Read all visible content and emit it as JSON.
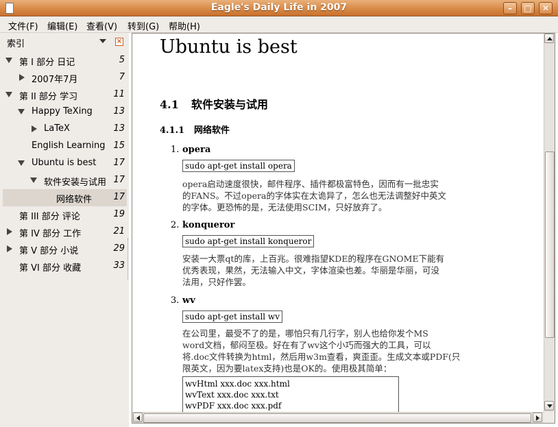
{
  "window": {
    "title": "Eagle's Daily Life in 2007"
  },
  "menu": [
    "文件(F)",
    "编辑(E)",
    "查看(V)",
    "转到(G)",
    "帮助(H)"
  ],
  "sidebar": {
    "title": "索引",
    "items": [
      {
        "label": "第 I 部分 日记",
        "page": "5"
      },
      {
        "label": "2007年7月",
        "page": "7"
      },
      {
        "label": "第 II 部分 学习",
        "page": "11"
      },
      {
        "label": "Happy TeXing",
        "page": "13"
      },
      {
        "label": "LaTeX",
        "page": "13"
      },
      {
        "label": "English Learning",
        "page": "15"
      },
      {
        "label": "Ubuntu is best",
        "page": "17"
      },
      {
        "label": "软件安装与试用",
        "page": "17"
      },
      {
        "label": "网络软件",
        "page": "17"
      },
      {
        "label": "第 III 部分 评论",
        "page": "19"
      },
      {
        "label": "第 IV 部分 工作",
        "page": "21"
      },
      {
        "label": "第 V 部分 小说",
        "page": "29"
      },
      {
        "label": "第 VI 部分 收藏",
        "page": "33"
      }
    ]
  },
  "document": {
    "chapter_title": "Ubuntu is best",
    "section": {
      "number": "4.1",
      "title": "软件安装与试用"
    },
    "subsection": {
      "number": "4.1.1",
      "title": "网络软件"
    },
    "items": [
      {
        "number": "1.",
        "name": "opera",
        "command": "sudo apt-get install opera",
        "lines": [
          "opera启动速度很快，邮件程序、插件都极富特色，因而有一批忠实",
          "的FANS。不过opera的字体实在太诡异了，怎么也无法调整好中英文",
          "的字体。更恐怖的是，无法使用SCIM，只好放弃了。"
        ]
      },
      {
        "number": "2.",
        "name": "konqueror",
        "command": "sudo apt-get install konqueror",
        "lines": [
          "安装一大票qt的库，上百兆。很难指望KDE的程序在GNOME下能有",
          "优秀表现，果然，无法输入中文，字体渲染也差。华丽是华丽，可没",
          "法用，只好作罢。"
        ]
      },
      {
        "number": "3.",
        "name": "wv",
        "command": "sudo apt-get install wv",
        "lines": [
          "在公司里，最受不了的是，哪怕只有几行字，别人也给你发个MS",
          "word文档，郁闷至极。好在有了wv这个小巧而强大的工具，可以",
          "将.doc文件转换为html，然后用w3m查看，爽歪歪。生成文本或PDF(只",
          "限英文，因为要latex支持)也是OK的。使用极其简单："
        ]
      }
    ],
    "code_lines": [
      "wvHtml xxx.doc xxx.html",
      "wvText xxx.doc xxx.txt",
      "wvPDF xxx.doc xxx.pdf"
    ]
  }
}
